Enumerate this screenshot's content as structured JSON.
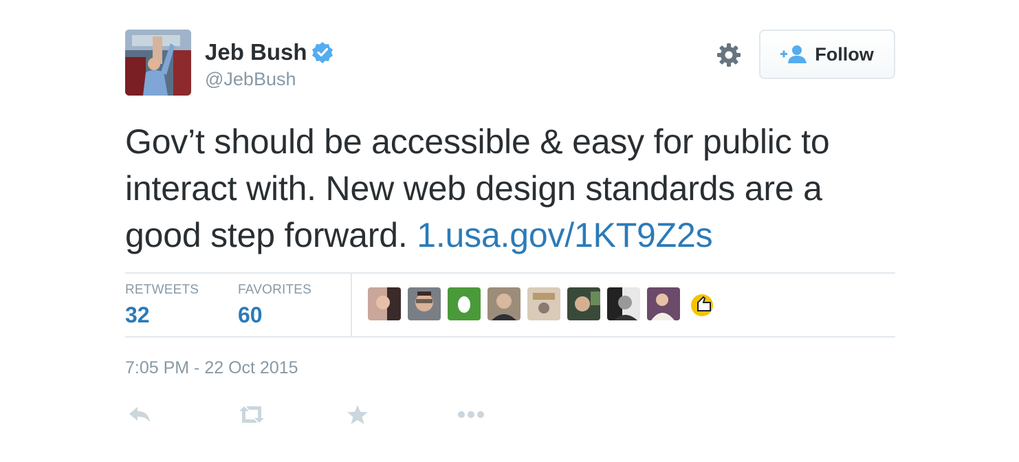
{
  "tweet": {
    "fullname": "Jeb Bush",
    "handle": "@JebBush",
    "text_main": "Gov’t should be accessible & easy for public to interact with. New web design standards are a good step forward. ",
    "link_text": "1.usa.gov/1KT9Z2s",
    "timestamp": "7:05 PM - 22 Oct 2015"
  },
  "follow_button": {
    "label": "Follow"
  },
  "stats": {
    "retweets_label": "RETWEETS",
    "retweets_value": "32",
    "favorites_label": "FAVORITES",
    "favorites_value": "60"
  },
  "colors": {
    "link": "#2b7bb9",
    "muted": "#8899a6",
    "verified": "#55acee",
    "text": "#292f33"
  },
  "icons": {
    "verified": "verified-badge-icon",
    "settings": "gear-icon",
    "follow": "add-user-icon",
    "reply": "reply-icon",
    "retweet": "retweet-icon",
    "favorite": "star-icon",
    "more": "more-icon"
  }
}
